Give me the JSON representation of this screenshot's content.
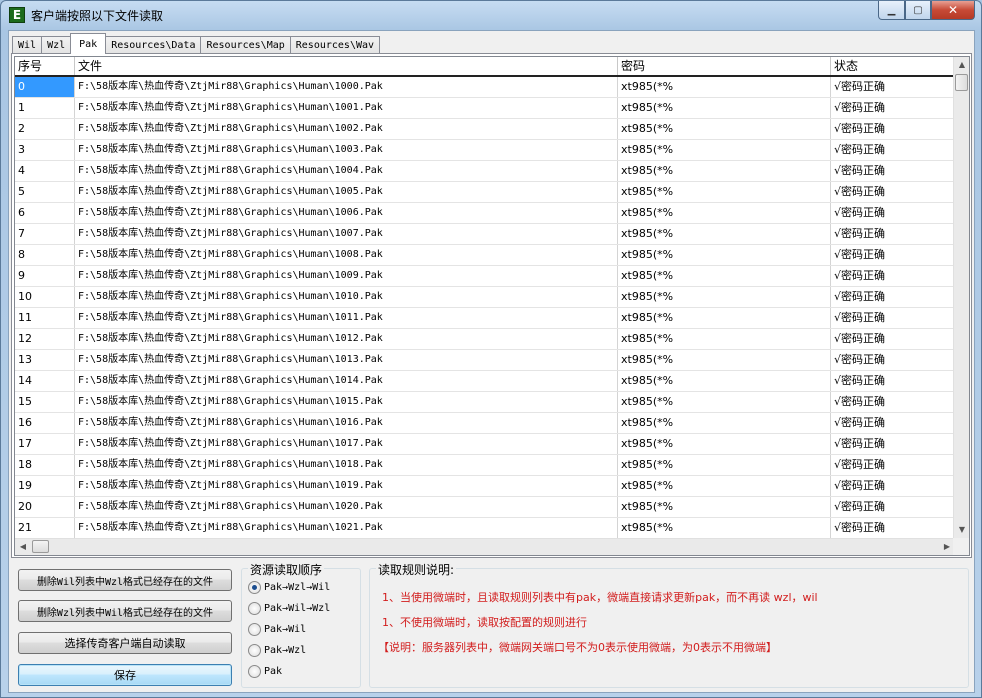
{
  "window": {
    "title": "客户端按照以下文件读取",
    "icon_letter": "E",
    "minimize_glyph": "▁",
    "maximize_glyph": "▢",
    "close_glyph": "✕"
  },
  "tabs": [
    {
      "label": "Wil",
      "active": false
    },
    {
      "label": "Wzl",
      "active": false
    },
    {
      "label": "Pak",
      "active": true
    },
    {
      "label": "Resources\\Data",
      "active": false
    },
    {
      "label": "Resources\\Map",
      "active": false
    },
    {
      "label": "Resources\\Wav",
      "active": false
    }
  ],
  "grid": {
    "columns": [
      "序号",
      "文件",
      "密码",
      "状态"
    ],
    "rows": [
      [
        "0",
        "F:\\58版本库\\热血传奇\\ZtjMir88\\Graphics\\Human\\1000.Pak",
        "xt985(*%",
        "√密码正确"
      ],
      [
        "1",
        "F:\\58版本库\\热血传奇\\ZtjMir88\\Graphics\\Human\\1001.Pak",
        "xt985(*%",
        "√密码正确"
      ],
      [
        "2",
        "F:\\58版本库\\热血传奇\\ZtjMir88\\Graphics\\Human\\1002.Pak",
        "xt985(*%",
        "√密码正确"
      ],
      [
        "3",
        "F:\\58版本库\\热血传奇\\ZtjMir88\\Graphics\\Human\\1003.Pak",
        "xt985(*%",
        "√密码正确"
      ],
      [
        "4",
        "F:\\58版本库\\热血传奇\\ZtjMir88\\Graphics\\Human\\1004.Pak",
        "xt985(*%",
        "√密码正确"
      ],
      [
        "5",
        "F:\\58版本库\\热血传奇\\ZtjMir88\\Graphics\\Human\\1005.Pak",
        "xt985(*%",
        "√密码正确"
      ],
      [
        "6",
        "F:\\58版本库\\热血传奇\\ZtjMir88\\Graphics\\Human\\1006.Pak",
        "xt985(*%",
        "√密码正确"
      ],
      [
        "7",
        "F:\\58版本库\\热血传奇\\ZtjMir88\\Graphics\\Human\\1007.Pak",
        "xt985(*%",
        "√密码正确"
      ],
      [
        "8",
        "F:\\58版本库\\热血传奇\\ZtjMir88\\Graphics\\Human\\1008.Pak",
        "xt985(*%",
        "√密码正确"
      ],
      [
        "9",
        "F:\\58版本库\\热血传奇\\ZtjMir88\\Graphics\\Human\\1009.Pak",
        "xt985(*%",
        "√密码正确"
      ],
      [
        "10",
        "F:\\58版本库\\热血传奇\\ZtjMir88\\Graphics\\Human\\1010.Pak",
        "xt985(*%",
        "√密码正确"
      ],
      [
        "11",
        "F:\\58版本库\\热血传奇\\ZtjMir88\\Graphics\\Human\\1011.Pak",
        "xt985(*%",
        "√密码正确"
      ],
      [
        "12",
        "F:\\58版本库\\热血传奇\\ZtjMir88\\Graphics\\Human\\1012.Pak",
        "xt985(*%",
        "√密码正确"
      ],
      [
        "13",
        "F:\\58版本库\\热血传奇\\ZtjMir88\\Graphics\\Human\\1013.Pak",
        "xt985(*%",
        "√密码正确"
      ],
      [
        "14",
        "F:\\58版本库\\热血传奇\\ZtjMir88\\Graphics\\Human\\1014.Pak",
        "xt985(*%",
        "√密码正确"
      ],
      [
        "15",
        "F:\\58版本库\\热血传奇\\ZtjMir88\\Graphics\\Human\\1015.Pak",
        "xt985(*%",
        "√密码正确"
      ],
      [
        "16",
        "F:\\58版本库\\热血传奇\\ZtjMir88\\Graphics\\Human\\1016.Pak",
        "xt985(*%",
        "√密码正确"
      ],
      [
        "17",
        "F:\\58版本库\\热血传奇\\ZtjMir88\\Graphics\\Human\\1017.Pak",
        "xt985(*%",
        "√密码正确"
      ],
      [
        "18",
        "F:\\58版本库\\热血传奇\\ZtjMir88\\Graphics\\Human\\1018.Pak",
        "xt985(*%",
        "√密码正确"
      ],
      [
        "19",
        "F:\\58版本库\\热血传奇\\ZtjMir88\\Graphics\\Human\\1019.Pak",
        "xt985(*%",
        "√密码正确"
      ],
      [
        "20",
        "F:\\58版本库\\热血传奇\\ZtjMir88\\Graphics\\Human\\1020.Pak",
        "xt985(*%",
        "√密码正确"
      ],
      [
        "21",
        "F:\\58版本库\\热血传奇\\ZtjMir88\\Graphics\\Human\\1021.Pak",
        "xt985(*%",
        "√密码正确"
      ]
    ],
    "selected_row": 0
  },
  "buttons": {
    "delete_wil": "删除Wil列表中Wzl格式已经存在的文件",
    "delete_wzl": "删除Wzl列表中Wil格式已经存在的文件",
    "auto_read": "选择传奇客户端自动读取",
    "save": "保存"
  },
  "read_order": {
    "title": "资源读取顺序",
    "options": [
      {
        "label": "Pak→Wzl→Wil",
        "checked": true
      },
      {
        "label": "Pak→Wil→Wzl",
        "checked": false
      },
      {
        "label": "Pak→Wil",
        "checked": false
      },
      {
        "label": "Pak→Wzl",
        "checked": false
      },
      {
        "label": "Pak",
        "checked": false
      }
    ]
  },
  "rules": {
    "title": "读取规则说明:",
    "lines": [
      "1、当使用微端时，且读取规则列表中有pak，微端直接请求更新pak，而不再读 wzl，wil",
      "1、不使用微端时，读取按配置的规则进行",
      "【说明：服务器列表中，微端网关端口号不为0表示使用微端，为0表示不用微端】"
    ]
  }
}
